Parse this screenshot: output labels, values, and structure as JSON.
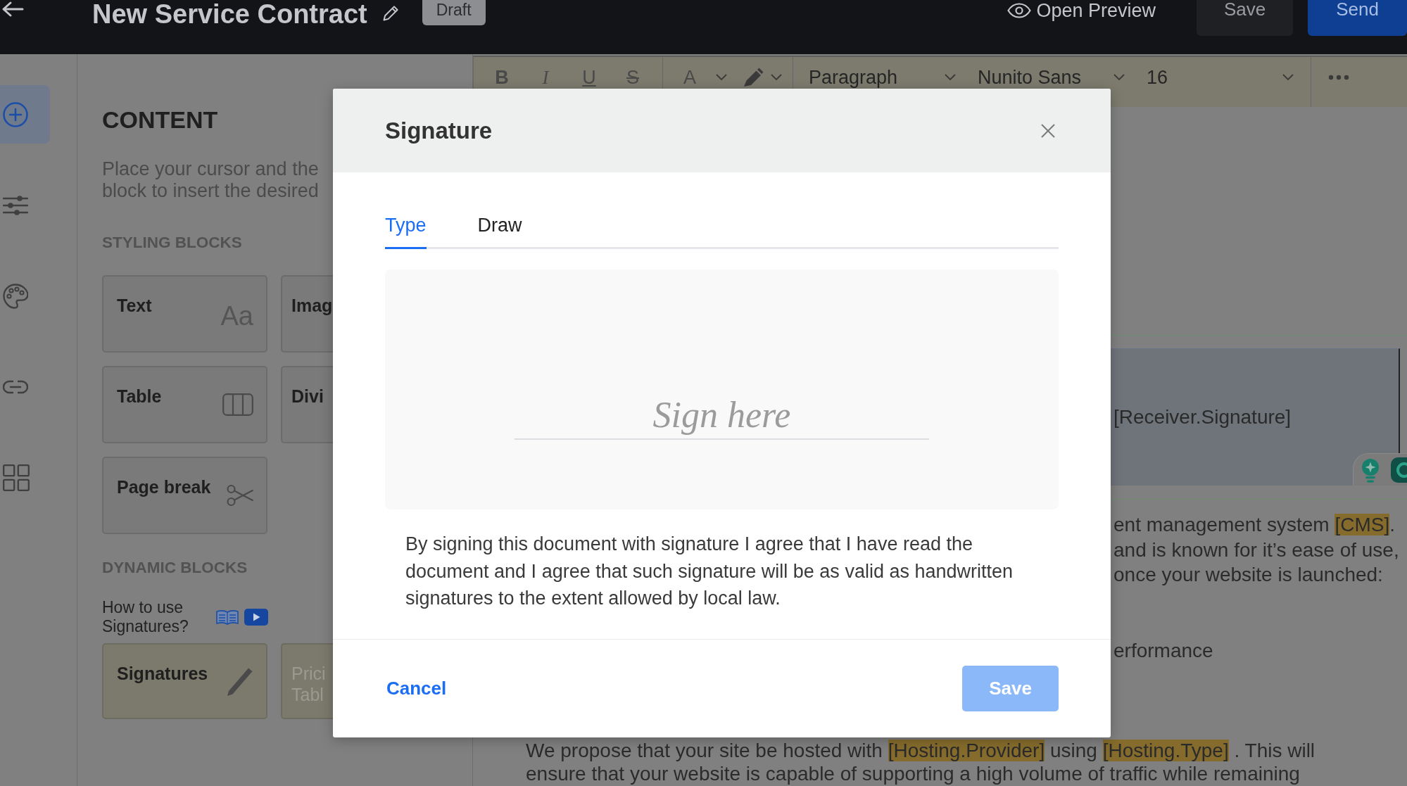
{
  "header": {
    "title": "New Service Contract",
    "status": "Draft",
    "preview": "Open Preview",
    "actions": [
      {
        "label": "Save",
        "kind": "secondary"
      },
      {
        "label": "Send",
        "kind": "primary"
      }
    ]
  },
  "rail": {
    "items": [
      {
        "selected": true
      },
      {
        "selected": false
      },
      {
        "selected": false
      },
      {
        "selected": false
      },
      {
        "selected": false
      }
    ]
  },
  "content_panel": {
    "title": "CONTENT",
    "description_lines": [
      "Place your cursor and the",
      "block to insert the desired"
    ],
    "styling_blocks": {
      "heading": "STYLING BLOCKS",
      "blocks": [
        {
          "label": "Text",
          "kind": "text",
          "glyph": "Aa"
        },
        {
          "label": "Imag",
          "kind": "image"
        },
        {
          "label": "Table",
          "kind": "table"
        },
        {
          "label": "Divi",
          "kind": "divider"
        },
        {
          "label": "Page break",
          "kind": "page_break"
        }
      ]
    },
    "dynamic_blocks": {
      "heading": "DYNAMIC BLOCKS",
      "help": "How to use Signatures?",
      "blocks": [
        {
          "label": "Signatures",
          "kind": "signatures",
          "disabled": false
        },
        {
          "label": "Prici Tabl",
          "kind": "pricing_table",
          "disabled": true
        }
      ]
    }
  },
  "toolbar": {
    "format_buttons": [
      {
        "label": "B",
        "kind": "bold"
      },
      {
        "label": "I",
        "kind": "italic"
      },
      {
        "label": "U",
        "kind": "underline"
      },
      {
        "label": "S",
        "kind": "strikethrough"
      }
    ],
    "text_color": "A",
    "dropdowns": [
      "Paragraph",
      "Nunito Sans",
      "16"
    ]
  },
  "document": {
    "signature_tag": "[Receiver.Signature]",
    "fragments": [
      {
        "lines": [
          [
            {
              "text": "ent management system ",
              "highlight": false
            },
            {
              "text": "[CMS]",
              "highlight": true
            },
            {
              "text": ".",
              "highlight": false
            }
          ],
          [
            {
              "text": "and is known for it’s ease of use,",
              "highlight": false
            }
          ],
          [
            {
              "text": "once your website is launched:",
              "highlight": false
            }
          ]
        ]
      },
      {
        "lines": [
          [
            {
              "text": "erformance",
              "highlight": false
            }
          ]
        ]
      }
    ],
    "paragraph": [
      {
        "text": "We propose that your site be hosted with ",
        "highlight": false
      },
      {
        "text": "[Hosting.Provider]",
        "highlight": true
      },
      {
        "text": " using ",
        "highlight": false
      },
      {
        "text": "[Hosting.Type]",
        "highlight": true
      },
      {
        "text": " . This will ensure that your website is capable of supporting a high volume of traffic while remaining",
        "highlight": false
      }
    ]
  },
  "modal": {
    "title": "Signature",
    "tabs": [
      {
        "label": "Type",
        "selected": true
      },
      {
        "label": "Draw",
        "selected": false
      }
    ],
    "signature_input": {
      "placeholder": "Sign here"
    },
    "consent": "By signing this document with signature I agree that I have read the document and I agree that such signature will be as valid as handwritten signatures to the extent allowed by local law.",
    "cancel": "Cancel",
    "save": {
      "label": "Save",
      "disabled": true
    }
  }
}
